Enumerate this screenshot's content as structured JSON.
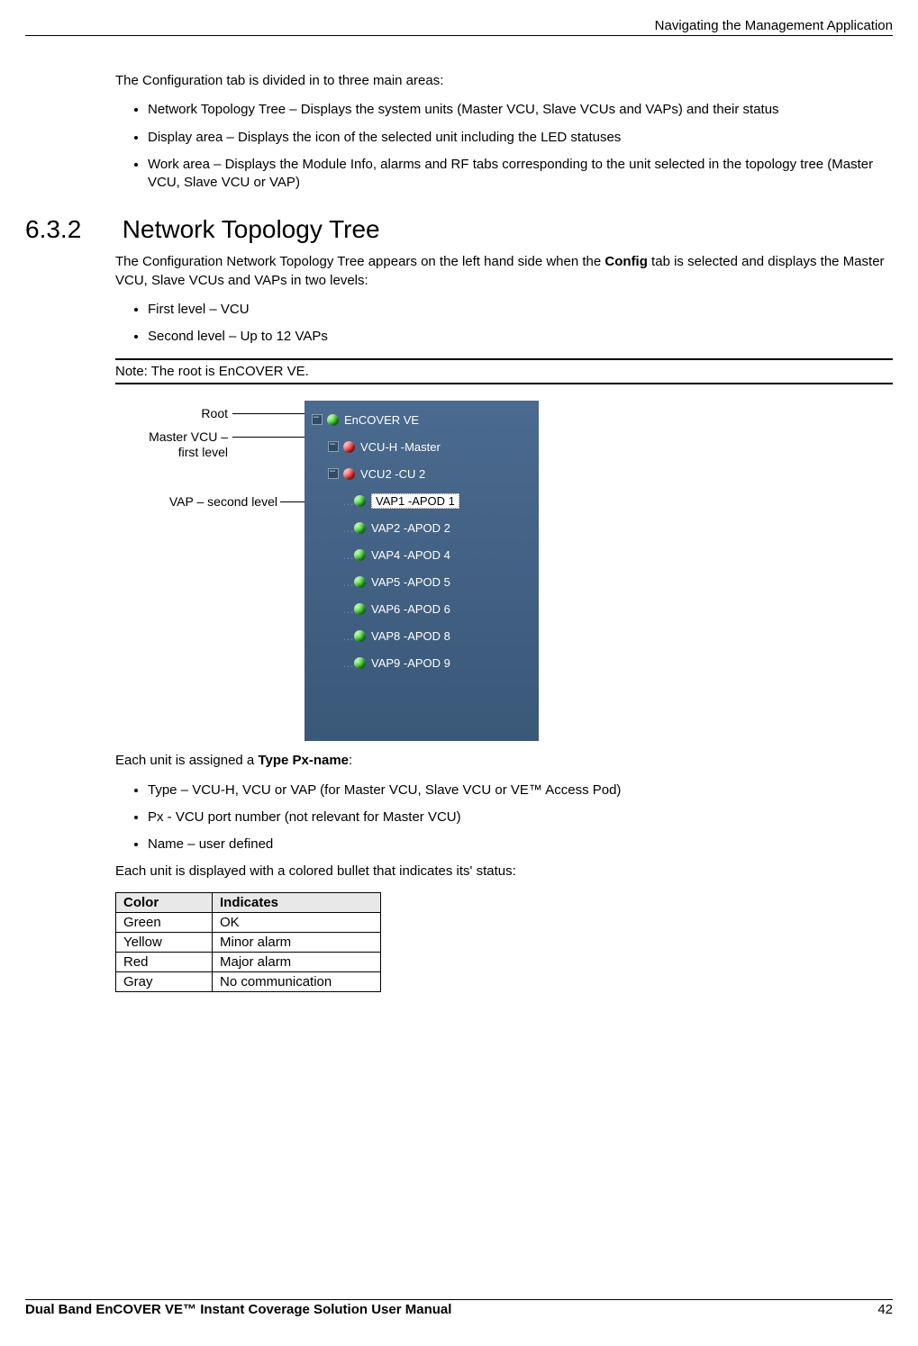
{
  "header": {
    "chapter": "Navigating the Management Application"
  },
  "intro": {
    "p1": "The Configuration tab is divided in to three main areas:",
    "items": [
      "Network Topology Tree – Displays the system units (Master VCU, Slave VCUs and VAPs) and their status",
      "Display area – Displays the icon of the selected unit including the LED statuses",
      "Work area – Displays the Module Info, alarms and RF tabs corresponding to the unit selected in the topology tree (Master VCU, Slave VCU or VAP)"
    ]
  },
  "section": {
    "num": "6.3.2",
    "title": "Network Topology Tree"
  },
  "section_body": {
    "p1_pre": "The Configuration Network Topology Tree appears on the left hand side when the ",
    "p1_bold": "Config",
    "p1_post": " tab is selected and displays the Master VCU, Slave VCUs and VAPs in two levels:",
    "levels": [
      "First level – VCU",
      "Second level – Up to 12 VAPs"
    ],
    "note": "Note: The root is EnCOVER VE."
  },
  "figure": {
    "callouts": {
      "root": "Root",
      "master_l1": "Master VCU –",
      "master_l2": "first level",
      "vap": "VAP – second level"
    },
    "tree": [
      {
        "indent": 0,
        "toggle": true,
        "status": "green",
        "label": "EnCOVER VE",
        "selected": false
      },
      {
        "indent": 1,
        "toggle": true,
        "status": "red",
        "label": "VCU-H -Master",
        "selected": false
      },
      {
        "indent": 1,
        "toggle": true,
        "status": "red",
        "label": "VCU2 -CU 2",
        "selected": false
      },
      {
        "indent": 2,
        "toggle": false,
        "status": "green",
        "label": "VAP1 -APOD 1",
        "selected": true
      },
      {
        "indent": 2,
        "toggle": false,
        "status": "green",
        "label": "VAP2 -APOD 2",
        "selected": false
      },
      {
        "indent": 2,
        "toggle": false,
        "status": "green",
        "label": "VAP4 -APOD 4",
        "selected": false
      },
      {
        "indent": 2,
        "toggle": false,
        "status": "green",
        "label": "VAP5 -APOD 5",
        "selected": false
      },
      {
        "indent": 2,
        "toggle": false,
        "status": "green",
        "label": "VAP6 -APOD 6",
        "selected": false
      },
      {
        "indent": 2,
        "toggle": false,
        "status": "green",
        "label": "VAP8 -APOD 8",
        "selected": false
      },
      {
        "indent": 2,
        "toggle": false,
        "status": "green",
        "label": "VAP9 -APOD 9",
        "selected": false
      }
    ]
  },
  "typepx": {
    "intro_pre": "Each unit is assigned a ",
    "intro_bold": "Type Px-name",
    "intro_post": ":",
    "items": [
      "Type – VCU-H, VCU or VAP (for Master VCU, Slave VCU or VE™ Access Pod)",
      "Px - VCU port number (not relevant for Master VCU)",
      "Name – user defined"
    ],
    "after": "Each unit is displayed with a colored bullet that indicates its' status:"
  },
  "status_table": {
    "headers": [
      "Color",
      "Indicates"
    ],
    "rows": [
      [
        "Green",
        "OK"
      ],
      [
        "Yellow",
        "Minor alarm"
      ],
      [
        "Red",
        "Major alarm"
      ],
      [
        "Gray",
        "No communication"
      ]
    ]
  },
  "footer": {
    "title": "Dual Band EnCOVER VE™ Instant Coverage Solution User Manual",
    "page": "42"
  },
  "chart_data": {
    "type": "table",
    "title": "Status bullet color legend",
    "columns": [
      "Color",
      "Indicates"
    ],
    "rows": [
      [
        "Green",
        "OK"
      ],
      [
        "Yellow",
        "Minor alarm"
      ],
      [
        "Red",
        "Major alarm"
      ],
      [
        "Gray",
        "No communication"
      ]
    ]
  }
}
